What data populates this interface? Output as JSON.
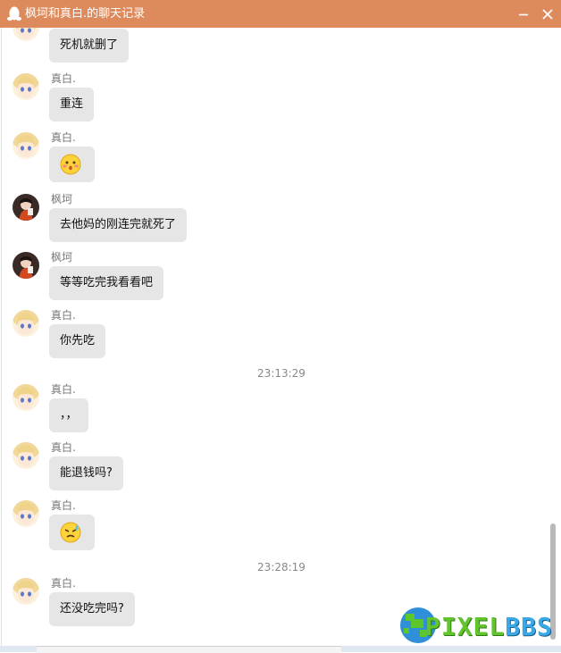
{
  "window": {
    "title": "枫坷和真白.的聊天记录",
    "minimize_icon": "minimize-icon",
    "close_icon": "close-icon",
    "brand_icon": "qq-penguin-icon",
    "titlebar_color": "#dd8a5c"
  },
  "messages": [
    {
      "sender": "",
      "avatar": "mashiro",
      "type": "text",
      "text": "死机就删了"
    },
    {
      "sender": "真白.",
      "avatar": "mashiro",
      "type": "text",
      "text": "重连"
    },
    {
      "sender": "真白.",
      "avatar": "mashiro",
      "type": "emoji",
      "icon": "blush-emoji-icon"
    },
    {
      "sender": "枫坷",
      "avatar": "fengke",
      "type": "text",
      "text": "去他妈的刚连完就死了"
    },
    {
      "sender": "枫坷",
      "avatar": "fengke",
      "type": "text",
      "text": "等等吃完我看看吧"
    },
    {
      "sender": "真白.",
      "avatar": "mashiro",
      "type": "text",
      "text": "你先吃"
    },
    {
      "sender": "真白.",
      "avatar": "mashiro",
      "type": "text",
      "text": "，，"
    },
    {
      "sender": "真白.",
      "avatar": "mashiro",
      "type": "text",
      "text": "能退钱吗?"
    },
    {
      "sender": "真白.",
      "avatar": "mashiro",
      "type": "emoji",
      "icon": "sweat-emoji-icon"
    },
    {
      "sender": "真白.",
      "avatar": "mashiro",
      "type": "text",
      "text": "还没吃完吗?"
    }
  ],
  "timestamps": [
    "23:13:29",
    "23:28:19"
  ],
  "watermark": {
    "part1": "PIXEL",
    "part2": "BBS"
  },
  "colors": {
    "bubble": "#e6e6e6",
    "accent": "#dd8a5c"
  }
}
